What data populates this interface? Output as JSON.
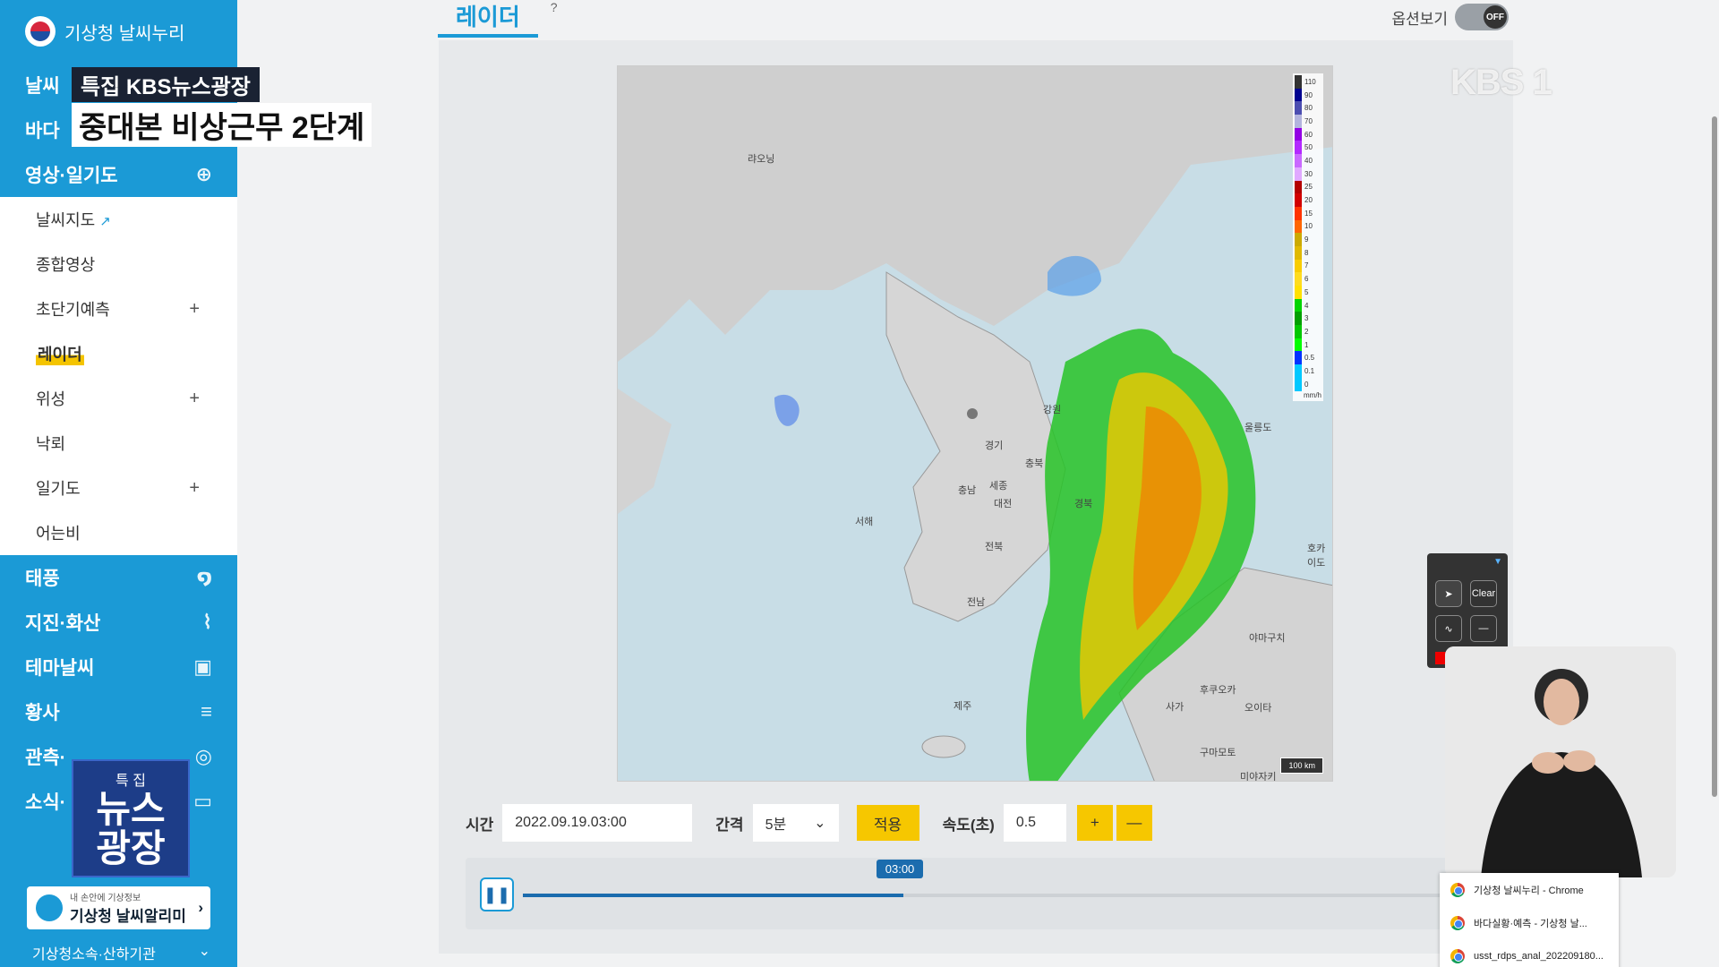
{
  "brand": {
    "title": "기상청 날씨누리"
  },
  "sidebar": {
    "top_items": [
      {
        "label": "날씨",
        "icon": "weather-icon"
      },
      {
        "label": "바다",
        "icon": "sea-icon"
      },
      {
        "label": "영상·일기도",
        "icon": "satellite-icon"
      }
    ],
    "submenu": [
      {
        "label": "날씨지도",
        "external": true
      },
      {
        "label": "종합영상"
      },
      {
        "label": "초단기예측",
        "plus": "+"
      },
      {
        "label": "레이더",
        "active": true
      },
      {
        "label": "위성",
        "plus": "+"
      },
      {
        "label": "낙뢰"
      },
      {
        "label": "일기도",
        "plus": "+"
      },
      {
        "label": "어는비"
      }
    ],
    "lower_items": [
      {
        "label": "태풍",
        "icon": "typhoon-icon"
      },
      {
        "label": "지진·화산",
        "icon": "earthquake-icon"
      },
      {
        "label": "테마날씨",
        "icon": "bag-icon"
      },
      {
        "label": "황사",
        "icon": "dust-icon"
      },
      {
        "label": "관측·",
        "icon": "observe-icon"
      },
      {
        "label": "소식·",
        "icon": "news-icon"
      }
    ],
    "app_banner": {
      "small": "내 손안에 기상정보",
      "title": "기상청 날씨알리미"
    },
    "footer": "기상청소속·산하기관"
  },
  "page": {
    "tab": "레이더",
    "help": "?",
    "option_label": "옵션보기",
    "toggle_state": "OFF"
  },
  "map": {
    "labels": [
      "랴오닝",
      "강원",
      "경기",
      "충북",
      "충남",
      "세종",
      "대전",
      "서해",
      "전북",
      "경북",
      "전남",
      "제주",
      "울릉도",
      "호카이도",
      "후쿠오카",
      "야마구치",
      "오이타",
      "사가",
      "구마모토",
      "미야자키"
    ],
    "legend_unit": "mm/h",
    "legend": [
      {
        "value": "110",
        "color": "#333333"
      },
      {
        "value": "90",
        "color": "#000390"
      },
      {
        "value": "80",
        "color": "#4c4eb1"
      },
      {
        "value": "70",
        "color": "#b3b4de"
      },
      {
        "value": "60",
        "color": "#9300e4"
      },
      {
        "value": "50",
        "color": "#b329ff"
      },
      {
        "value": "40",
        "color": "#c969ff"
      },
      {
        "value": "30",
        "color": "#e0a9ff"
      },
      {
        "value": "25",
        "color": "#b40000"
      },
      {
        "value": "20",
        "color": "#d20000"
      },
      {
        "value": "15",
        "color": "#ff3300"
      },
      {
        "value": "10",
        "color": "#ff6600"
      },
      {
        "value": "9",
        "color": "#ccaa00"
      },
      {
        "value": "8",
        "color": "#e0b900"
      },
      {
        "value": "7",
        "color": "#f9cd00"
      },
      {
        "value": "6",
        "color": "#ffdc1f"
      },
      {
        "value": "5",
        "color": "#ffe100"
      },
      {
        "value": "4",
        "color": "#00d500"
      },
      {
        "value": "3",
        "color": "#00a000"
      },
      {
        "value": "2",
        "color": "#00c800"
      },
      {
        "value": "1",
        "color": "#00ff00"
      },
      {
        "value": "0.5",
        "color": "#0033ff"
      },
      {
        "value": "0.1",
        "color": "#00c8ff"
      },
      {
        "value": "0",
        "color": "#00c8ff"
      }
    ],
    "scale": "100 km"
  },
  "controls": {
    "time_label": "시간",
    "time_value": "2022.09.19.03:00",
    "interval_label": "간격",
    "interval_value": "5분",
    "apply": "적용",
    "speed_label": "속도(초)",
    "speed_value": "0.5",
    "plus": "+",
    "minus": "—"
  },
  "timeline": {
    "marker": "03:00",
    "progress": 0.41
  },
  "drawtool": {
    "clear": "Clear"
  },
  "overlay": {
    "caption_top": "특집 KBS뉴스광장",
    "caption_main": "중대본 비상근무 2단계",
    "kbs_logo": "KBS 1",
    "news_logo_top": "특 집",
    "news_logo_main_1": "뉴스",
    "news_logo_main_2": "광장"
  },
  "taskbar_popup": [
    "기상청 날씨누리 - Chrome",
    "바다실황·예측 - 기상청 날...",
    "usst_rdps_anal_202209180..."
  ]
}
